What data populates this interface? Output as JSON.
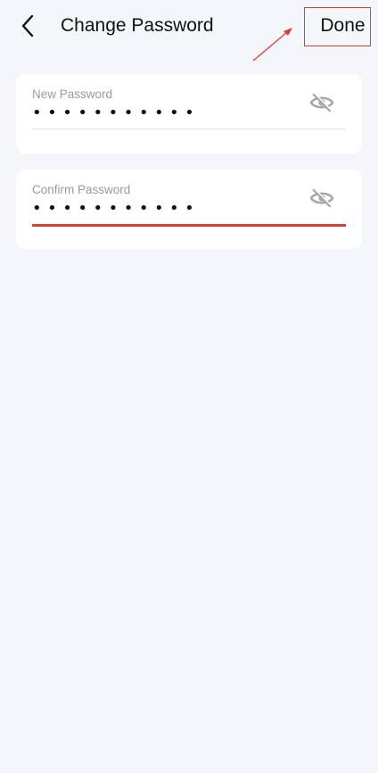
{
  "header": {
    "title": "Change Password",
    "done_label": "Done",
    "back_icon": "chevron-left-icon"
  },
  "form": {
    "new_password": {
      "label": "New Password",
      "value": "•••••••••••",
      "visibility_icon": "eye-off-icon",
      "focused": false
    },
    "confirm_password": {
      "label": "Confirm Password",
      "value": "•••••••••••",
      "visibility_icon": "eye-off-icon",
      "focused": true
    }
  },
  "colors": {
    "background": "#f5f6fa",
    "card": "#ffffff",
    "accent_focus": "#d6413a",
    "annotation": "#e53935",
    "label": "#9a9a9a",
    "text": "#111111",
    "icon": "#a7a7a7"
  }
}
